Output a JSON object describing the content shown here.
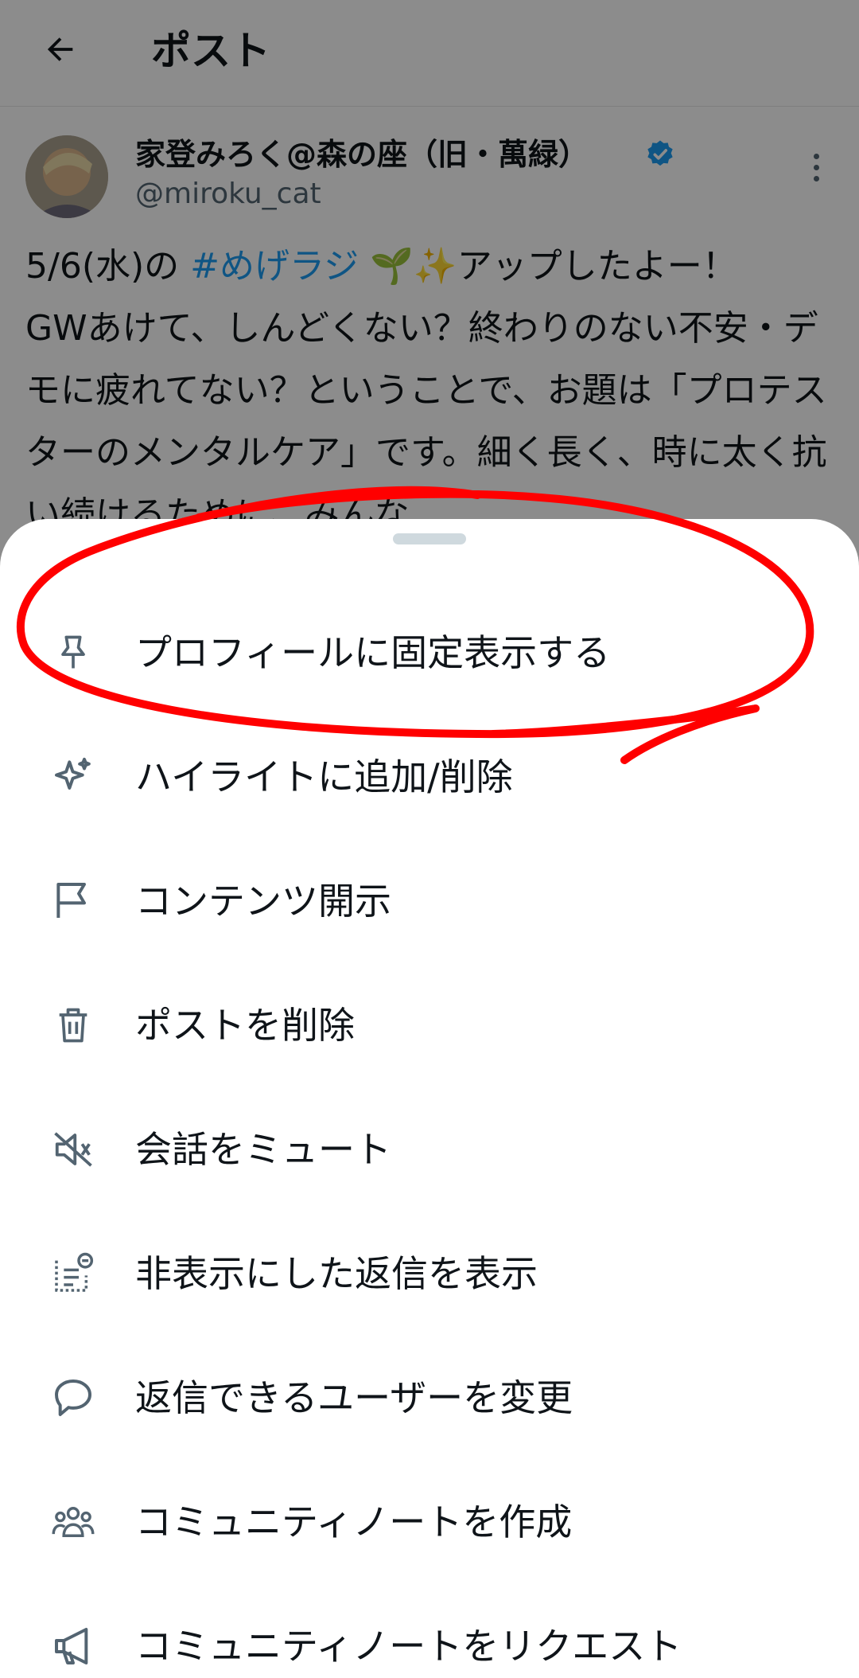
{
  "header": {
    "title": "ポスト"
  },
  "post": {
    "author_name": "家登みろく@森の座（旧・萬緑）",
    "handle": "@miroku_cat",
    "text_before": "5/6(水)の ",
    "hashtag": "#めげラジ",
    "text_after": " 🌱✨アップしたよー！\nGWあけて、しんどくない？終わりのない不安・デモに疲れてない？ということで、お題は「プロテスターのメンタルケア」です。細く長く、時に太く抗い続けるために、みんな"
  },
  "menu": {
    "items": [
      {
        "label": "プロフィールに固定表示する",
        "icon": "pin-icon"
      },
      {
        "label": "ハイライトに追加/削除",
        "icon": "sparkle-icon"
      },
      {
        "label": "コンテンツ開示",
        "icon": "flag-icon"
      },
      {
        "label": "ポストを削除",
        "icon": "trash-icon"
      },
      {
        "label": "会話をミュート",
        "icon": "mute-icon"
      },
      {
        "label": "非表示にした返信を表示",
        "icon": "hidden-replies-icon"
      },
      {
        "label": "返信できるユーザーを変更",
        "icon": "speech-bubble-icon"
      },
      {
        "label": "コミュニティノートを作成",
        "icon": "community-icon"
      },
      {
        "label": "コミュニティノートをリクエスト",
        "icon": "megaphone-icon"
      }
    ]
  },
  "colors": {
    "accent": "#1d9bf0",
    "icon_gray": "#536471",
    "annotation_red": "#ff0000"
  }
}
